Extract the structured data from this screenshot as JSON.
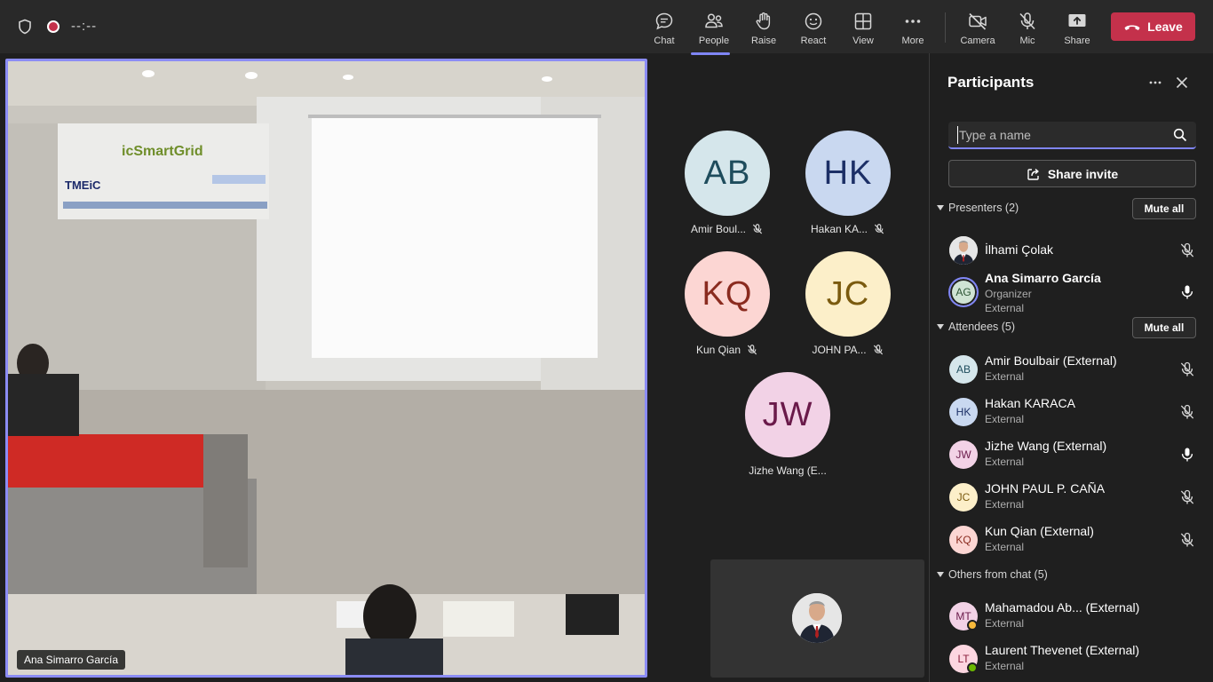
{
  "topbar": {
    "timer": "--:--",
    "buttons": {
      "chat": "Chat",
      "people": "People",
      "raise": "Raise",
      "react": "React",
      "view": "View",
      "more": "More",
      "camera": "Camera",
      "mic": "Mic",
      "share": "Share"
    },
    "leave": "Leave",
    "leave_color": "#c4314b",
    "accent_color": "#7f85f5"
  },
  "main_video": {
    "name": "Ana Simarro García",
    "banner_text": "icSmartGrid",
    "banner_logo": "TMEiC"
  },
  "gallery": [
    {
      "initials": "AB",
      "name": "Amir Boul...",
      "muted": true,
      "bg": "#d5e6eb",
      "fg": "#1e4c5c"
    },
    {
      "initials": "HK",
      "name": "Hakan KA...",
      "muted": true,
      "bg": "#c9d8f0",
      "fg": "#1c2f66"
    },
    {
      "initials": "KQ",
      "name": "Kun Qian",
      "muted": true,
      "bg": "#fcd6d3",
      "fg": "#8a2b1f"
    },
    {
      "initials": "JC",
      "name": "JOHN PA...",
      "muted": true,
      "bg": "#fcefc9",
      "fg": "#7a5a0e"
    },
    {
      "initials": "JW",
      "name": "Jizhe Wang (E...",
      "muted": false,
      "bg": "#f2d2e6",
      "fg": "#6a1a4a"
    }
  ],
  "panel": {
    "title": "Participants",
    "search_placeholder": "Type a name",
    "share_invite": "Share invite",
    "mute_all": "Mute all",
    "sections": {
      "presenters": "Presenters (2)",
      "attendees": "Attendees (5)",
      "others": "Others from chat (5)"
    },
    "presenters": [
      {
        "name": "İlhami Çolak",
        "muted": true
      },
      {
        "initials": "AG",
        "name": "Ana Simarro García",
        "role": "Organizer",
        "sub": "External",
        "muted": false
      }
    ],
    "attendees": [
      {
        "initials": "AB",
        "name": "Amir Boulbair (External)",
        "sub": "External",
        "muted": true
      },
      {
        "initials": "HK",
        "name": "Hakan KARACA",
        "sub": "External",
        "muted": true
      },
      {
        "initials": "JW",
        "name": "Jizhe Wang (External)",
        "sub": "External",
        "muted": false
      },
      {
        "initials": "JC",
        "name": "JOHN PAUL P. CAÑA",
        "sub": "External",
        "muted": true
      },
      {
        "initials": "KQ",
        "name": "Kun Qian (External)",
        "sub": "External",
        "muted": true
      }
    ],
    "others": [
      {
        "initials": "MT",
        "name": "Mahamadou Ab... (External)",
        "sub": "External",
        "status_color": "#f8b93b"
      },
      {
        "initials": "LT",
        "name": "Laurent Thevenet (External)",
        "sub": "External",
        "status_color": "#6bb700"
      }
    ]
  }
}
